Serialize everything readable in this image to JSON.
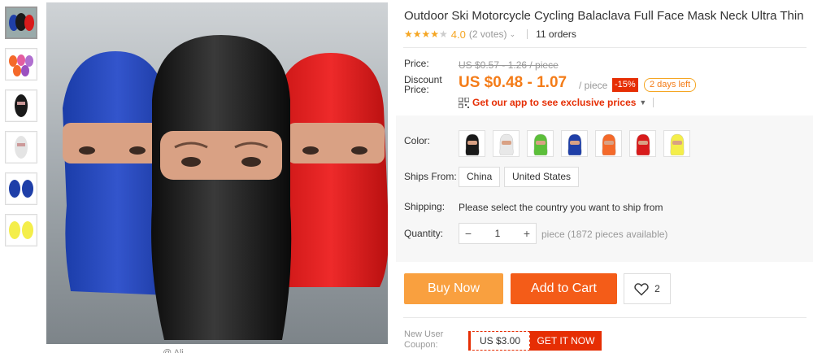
{
  "product": {
    "title": "Outdoor Ski Motorcycle Cycling Balaclava Full Face Mask Neck Ultra Thin",
    "rating": "4.0",
    "votes": "(2 votes)",
    "orders": "11 orders"
  },
  "pricing": {
    "price_label": "Price:",
    "old_price": "US $0.57 - 1.26 / piece",
    "discount_label_1": "Discount",
    "discount_label_2": "Price:",
    "price": "US $0.48 - 1.07",
    "per_piece": "/ piece",
    "discount_badge": "-15%",
    "days_left": "2 days left",
    "app_promo": "Get our app to see exclusive prices"
  },
  "options": {
    "color_label": "Color:",
    "colors": [
      {
        "name": "black",
        "hex": "#1a1a1a"
      },
      {
        "name": "white",
        "hex": "#e8e8e8"
      },
      {
        "name": "green",
        "hex": "#5cbf3a"
      },
      {
        "name": "blue",
        "hex": "#1f3fa8"
      },
      {
        "name": "orange",
        "hex": "#f4692a"
      },
      {
        "name": "red",
        "hex": "#d81b1b"
      },
      {
        "name": "yellow",
        "hex": "#f4ee4a"
      }
    ],
    "ships_from_label": "Ships From:",
    "ships_from": [
      "China",
      "United States"
    ],
    "shipping_label": "Shipping:",
    "shipping_text": "Please select the country you want to ship from",
    "quantity_label": "Quantity:",
    "quantity": "1",
    "quantity_note": "piece (1872 pieces available)"
  },
  "actions": {
    "buy_now": "Buy Now",
    "add_to_cart": "Add to Cart",
    "wishlist_count": "2"
  },
  "coupon": {
    "label_1": "New User",
    "label_2": "Coupon:",
    "value": "US $3.00",
    "cta": "GET IT NOW"
  },
  "gallery": {
    "thumbnails": [
      "multi-color",
      "orange-pink-purple",
      "black",
      "white",
      "blue",
      "yellow"
    ],
    "below_image_text": "@ Ali..."
  },
  "colors": {
    "accent_orange": "#f47c18",
    "buy_now_bg": "#f9a03f",
    "add_to_cart_bg": "#f45c18",
    "red": "#e62e04",
    "star": "#f5a623"
  }
}
